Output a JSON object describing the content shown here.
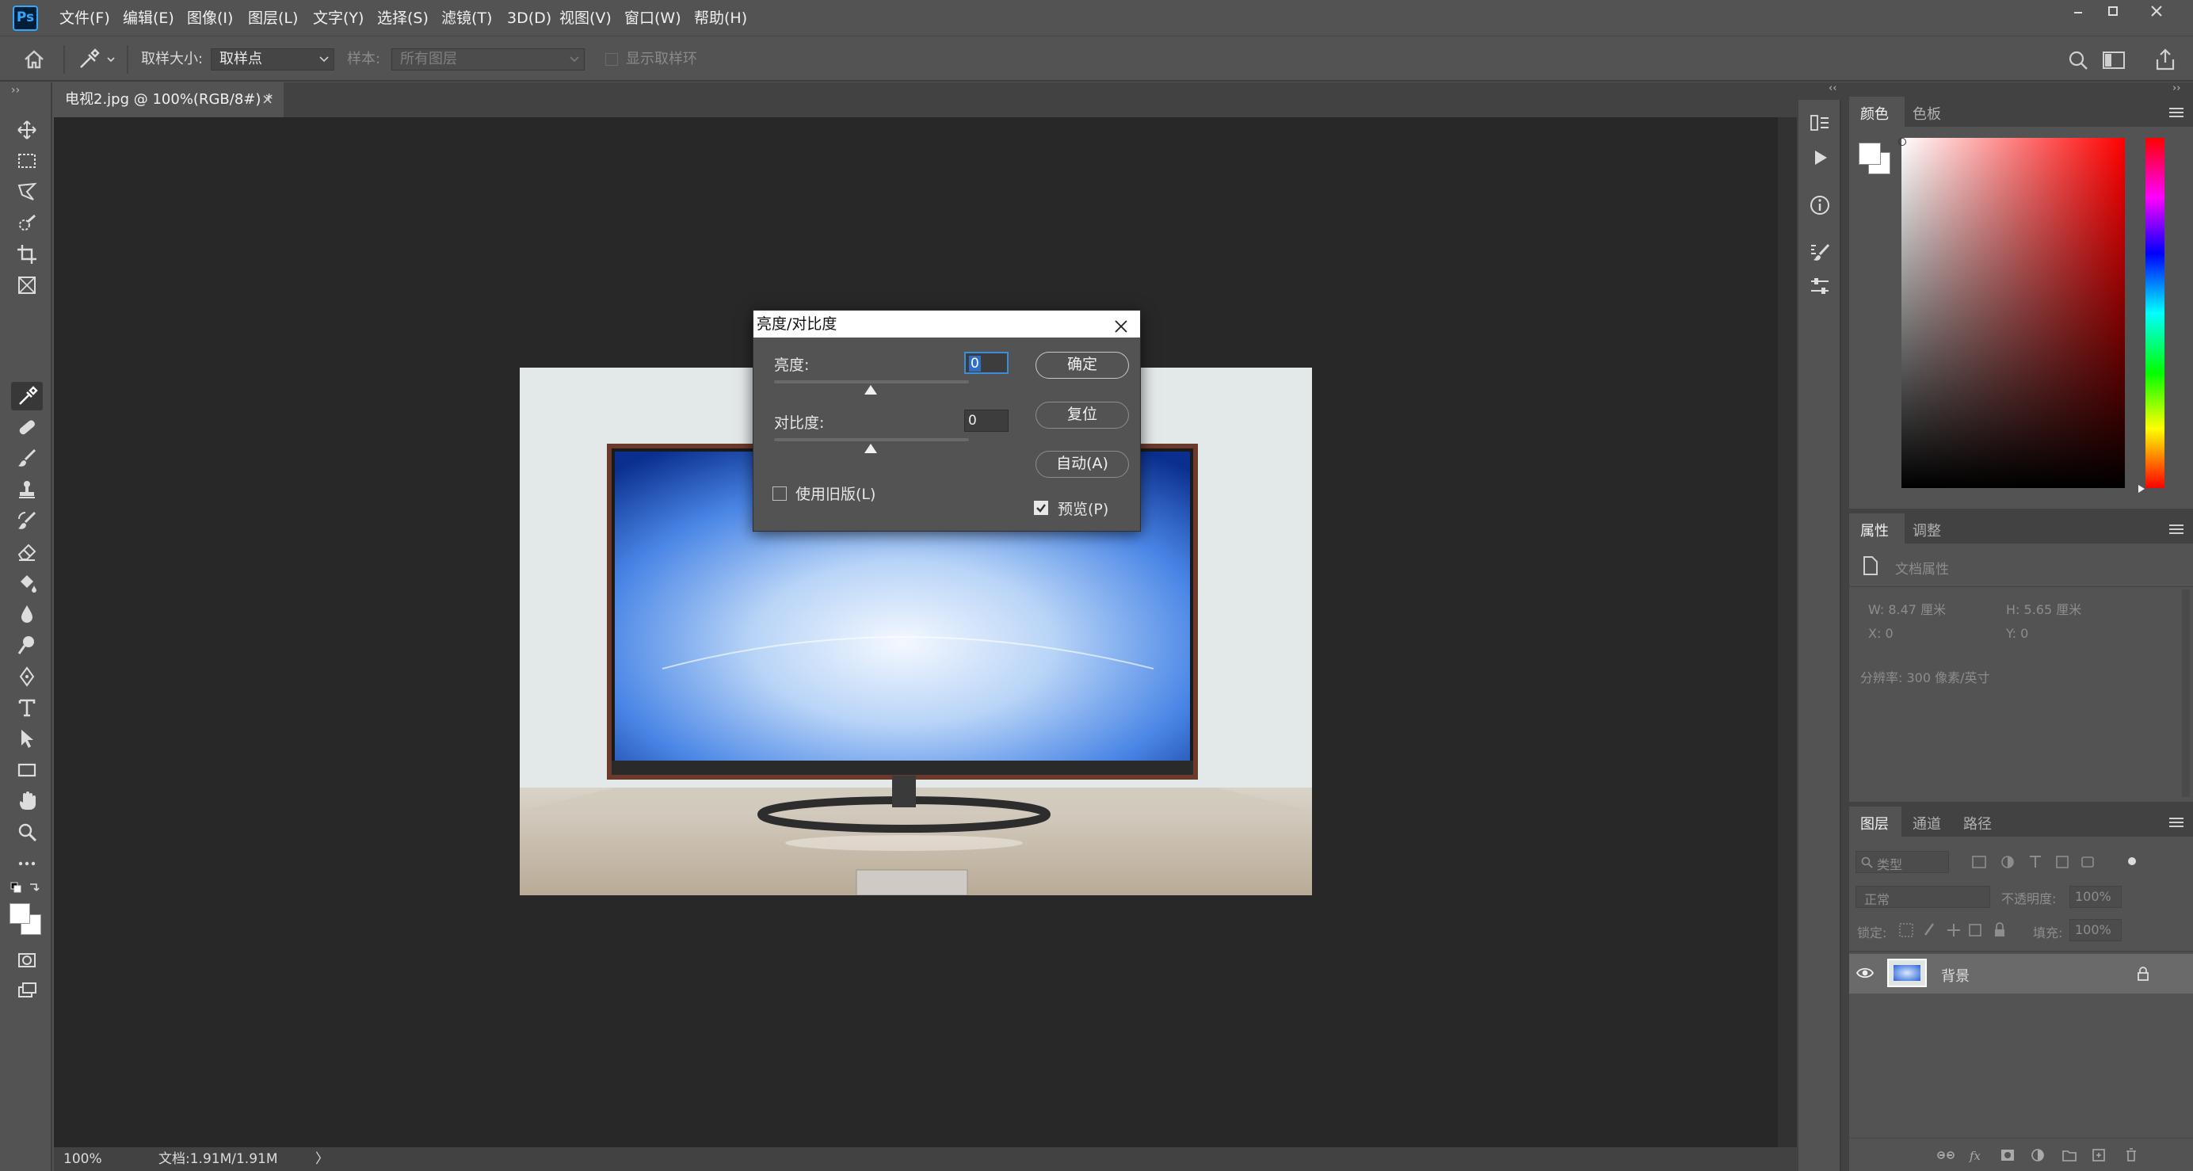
{
  "app": {
    "logo": "Ps"
  },
  "menu": [
    "文件(F)",
    "编辑(E)",
    "图像(I)",
    "图层(L)",
    "文字(Y)",
    "选择(S)",
    "滤镜(T)",
    "3D(D)",
    "视图(V)",
    "窗口(W)",
    "帮助(H)"
  ],
  "window_controls": {
    "minimize": "–",
    "maximize": "▫",
    "close": "✕"
  },
  "options": {
    "sample_size_label": "取样大小:",
    "sample_size_value": "取样点",
    "sample_label": "样本:",
    "sample_value": "所有图层",
    "show_ring_label": "显示取样环"
  },
  "document": {
    "tab_title": "电视2.jpg @ 100%(RGB/8#) *",
    "tab_close": "×",
    "zoom": "100%",
    "doc_size": "文档:1.91M/1.91M",
    "status_arrow": "〉"
  },
  "dialog": {
    "title": "亮度/对比度",
    "close": "✕",
    "brightness_label": "亮度:",
    "brightness_value": "0",
    "contrast_label": "对比度:",
    "contrast_value": "0",
    "legacy_label": "使用旧版(L)",
    "legacy_checked": false,
    "preview_label": "预览(P)",
    "preview_checked": true,
    "ok_label": "确定",
    "reset_label": "复位",
    "auto_label": "自动(A)"
  },
  "color_panel": {
    "tabs": [
      "颜色",
      "色板"
    ],
    "hue_color": "#ff0000"
  },
  "properties_panel": {
    "tabs": [
      "属性",
      "调整"
    ],
    "title": "文档属性",
    "w": "W:  8.47 厘米",
    "h": "H:  5.65 厘米",
    "x": "X:  0",
    "y": "Y:  0",
    "resolution": "分辨率: 300 像素/英寸"
  },
  "layers_panel": {
    "tabs": [
      "图层",
      "通道",
      "路径"
    ],
    "filter_placeholder": "类型",
    "blend_mode": "正常",
    "opacity_label": "不透明度:",
    "opacity_value": "100%",
    "lock_label": "锁定:",
    "fill_label": "填充:",
    "fill_value": "100%",
    "layers": [
      {
        "name": "背景",
        "visible": true,
        "locked": true
      }
    ]
  },
  "colors": {
    "accent": "#31a8ff",
    "panel_bg": "#535353",
    "canvas_bg": "#282828"
  }
}
